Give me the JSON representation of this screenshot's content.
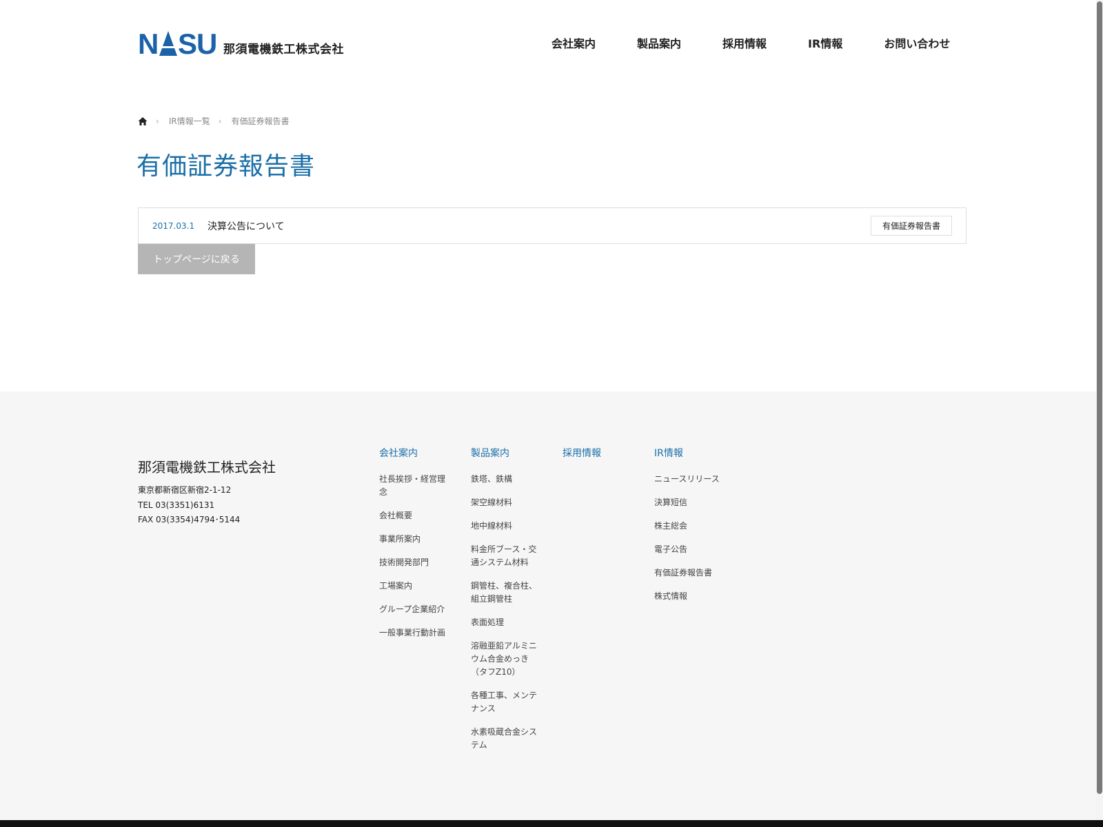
{
  "brand": {
    "logo_letters": "NASU",
    "name": "那須電機鉄工株式会社",
    "color": "#1b62a8"
  },
  "nav": [
    "会社案内",
    "製品案内",
    "採用情報",
    "IR情報",
    "お問い合わせ"
  ],
  "breadcrumb": {
    "home_icon": "home-icon",
    "items": [
      "IR情報一覧",
      "有価証券報告書"
    ]
  },
  "page_title": "有価証券報告書",
  "ir_list": [
    {
      "date": "2017.03.1",
      "title": "決算公告について",
      "tag": "有価証券報告書"
    }
  ],
  "back_button": "トップページに戻る",
  "footer": {
    "company": {
      "name": "那須電機鉄工株式会社",
      "address": "東京都新宿区新宿2-1-12",
      "tel": "TEL 03(3351)6131",
      "fax": "FAX 03(3354)4794･5144"
    },
    "columns": [
      {
        "head": "会社案内",
        "items": [
          "社長挨拶・経営理念",
          "会社概要",
          "事業所案内",
          "技術開発部門",
          "工場案内",
          "グループ企業紹介",
          "一般事業行動計画"
        ]
      },
      {
        "head": "製品案内",
        "items": [
          "鉄塔、鉄構",
          "架空線材料",
          "地中線材料",
          "料金所ブース・交通システム材料",
          "鋼管柱、複合柱、組立鋼管柱",
          "表面処理",
          "溶融亜鉛アルミニウム合金めっき（タフZ10）",
          "各種工事、メンテナンス",
          "水素吸蔵合金システム"
        ]
      },
      {
        "head": "採用情報",
        "items": []
      },
      {
        "head": "IR情報",
        "items": [
          "ニュースリリース",
          "決算短信",
          "株主総会",
          "電子公告",
          "有価証券報告書",
          "株式情報"
        ]
      }
    ]
  },
  "colors": {
    "accent": "#1b6fa8",
    "footer_bg": "#f6f6f6",
    "button_bg": "#b5b5b5"
  }
}
